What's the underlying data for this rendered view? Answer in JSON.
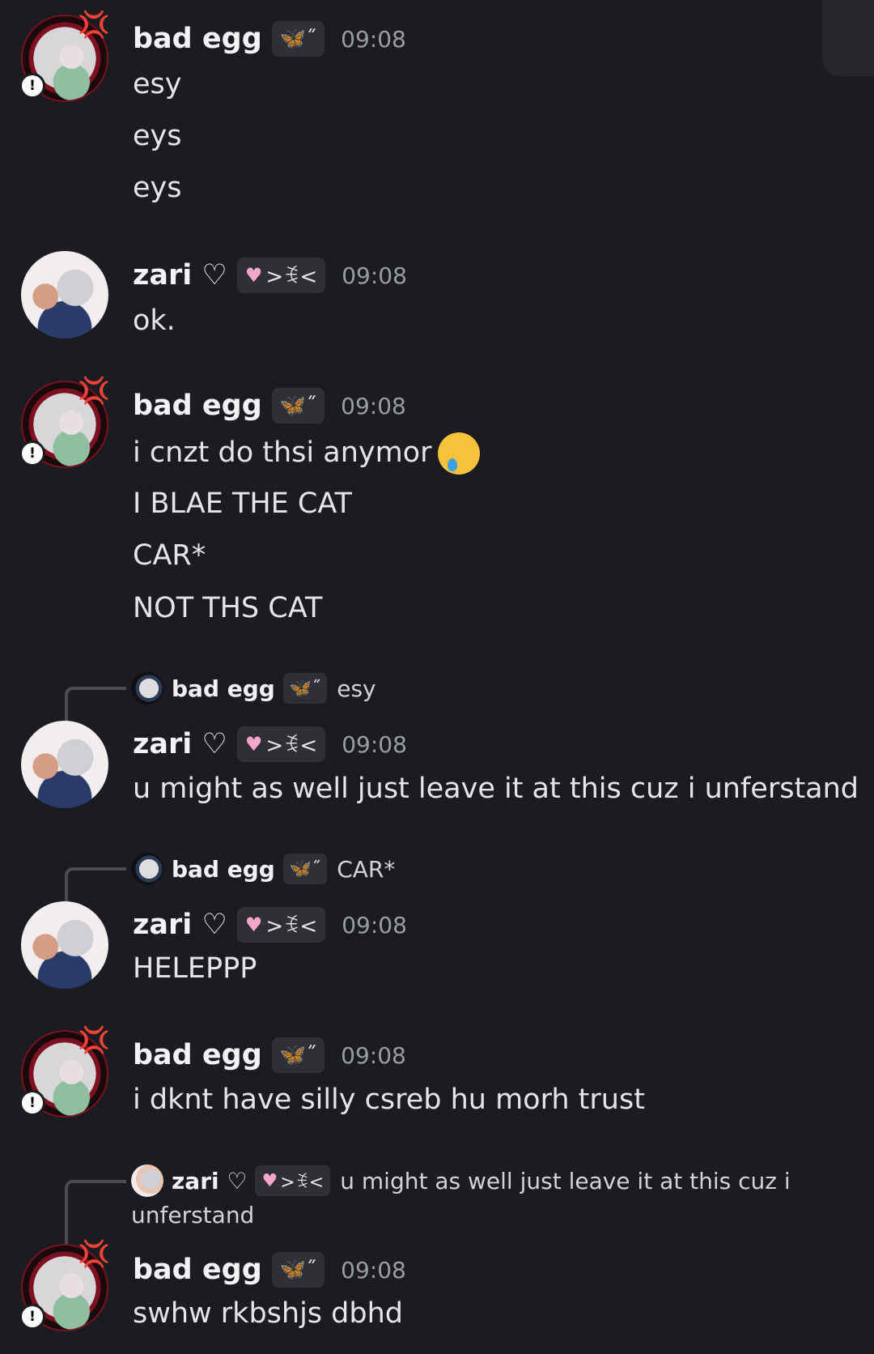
{
  "users": {
    "egg": {
      "name": "bad egg",
      "tag": "🦋˝"
    },
    "zari": {
      "name": "zari ♡",
      "tag_heart": "♥",
      "tag_text": ">ꉂ<"
    }
  },
  "warn_glyph": "!",
  "anger_glyph": "💢",
  "messages": [
    {
      "time": "09:08",
      "lines": [
        "esy",
        "eys",
        "eys"
      ]
    },
    {
      "time": "09:08",
      "lines": [
        "ok."
      ]
    },
    {
      "time": "09:08",
      "lines": [
        "i cnzt do thsi anymor",
        "I BLAE THE CAT",
        "CAR*",
        "NOT THS CAT"
      ]
    },
    {
      "time": "09:08",
      "reply_text": "esy",
      "lines": [
        "u might as well just leave it at this  cuz i unferstand"
      ]
    },
    {
      "time": "09:08",
      "reply_text": "CAR*",
      "lines": [
        "HELEPPP"
      ]
    },
    {
      "time": "09:08",
      "lines": [
        "i dknt have silly csreb hu morh trust"
      ]
    },
    {
      "time": "09:08",
      "reply_text_1": "u might as well just leave it at this  cuz i",
      "reply_text_2": "unferstand",
      "lines": [
        "swhw rkbshjs dbhd"
      ]
    }
  ]
}
